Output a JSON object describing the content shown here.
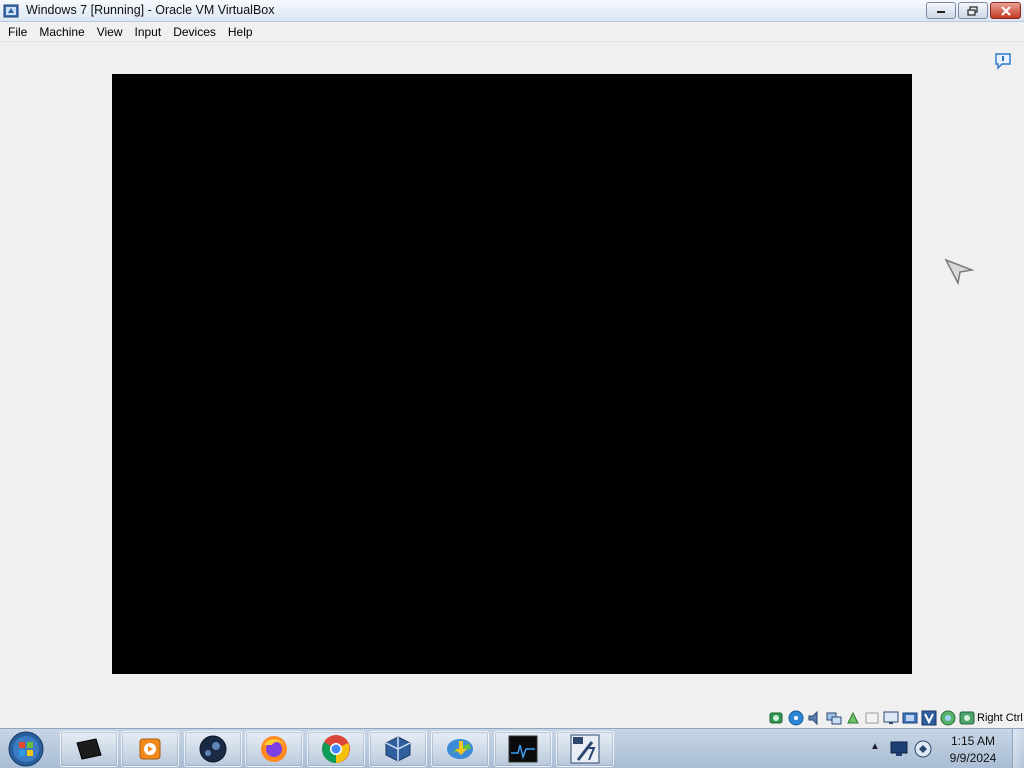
{
  "window": {
    "title": "Windows 7 [Running] - Oracle VM VirtualBox",
    "icon": "virtualbox-app-icon"
  },
  "menu": {
    "items": [
      "File",
      "Machine",
      "View",
      "Input",
      "Devices",
      "Help"
    ]
  },
  "status_bar": {
    "icons": [
      "hard-disk-icon",
      "optical-drive-icon",
      "audio-icon",
      "network-icon",
      "usb-icon",
      "shared-folders-icon",
      "display-icon",
      "video-capture-icon",
      "vt-x-icon",
      "mouse-integration-icon",
      "keyboard-icon"
    ],
    "host_key": "Right Ctrl"
  },
  "taskbar": {
    "start_icon": "windows-start-orb-icon",
    "pinned": [
      "terminal-icon",
      "media-player-icon",
      "steam-icon",
      "firefox-icon",
      "chrome-icon",
      "virtualbox-icon",
      "internet-download-manager-icon",
      "activity-monitor-icon",
      "windows7-64-icon"
    ]
  },
  "tray": {
    "time": "1:15 AM",
    "date": "9/9/2024"
  },
  "colors": {
    "vm_screen": "#000000",
    "background": "#f0f0f0",
    "taskbar": "#b6c7da"
  }
}
